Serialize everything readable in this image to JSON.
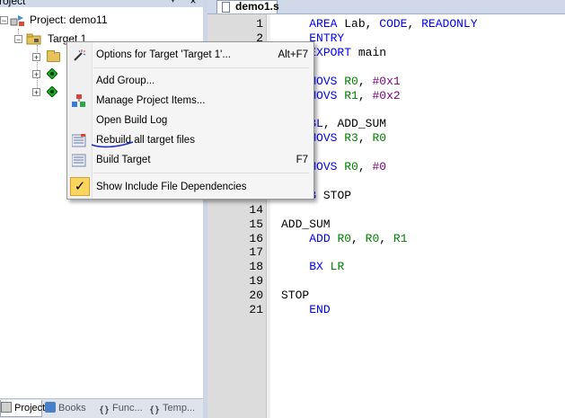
{
  "project_pane": {
    "title": "roject",
    "tree": {
      "project_label": "Project: demo11",
      "target_label": "Target 1"
    },
    "tabs": [
      {
        "label": "Project",
        "icon": "project-icon",
        "active": true
      },
      {
        "label": "Books",
        "icon": "books-icon",
        "active": false
      },
      {
        "label": "Func...",
        "icon": "functions-icon",
        "active": false
      },
      {
        "label": "Temp...",
        "icon": "templates-icon",
        "active": false
      }
    ]
  },
  "editor": {
    "file_tab": "demo1.s",
    "line_numbers": [
      "1",
      "2",
      "3",
      "4",
      "5",
      "6",
      "7",
      "8",
      "9",
      "10",
      "11",
      "12",
      "13",
      "14",
      "15",
      "16",
      "17",
      "18",
      "19",
      "20",
      "21"
    ],
    "code_lines": [
      "    AREA Lab, CODE, READONLY",
      "    ENTRY",
      "    EXPORT main",
      "",
      "    MOVS R0, #0x1",
      "    MOVS R1, #0x2",
      "",
      "    BL, ADD_SUM",
      "    MOVS R3, R0",
      "",
      "    MOVS R0, #0",
      "",
      "    B STOP",
      "",
      "ADD_SUM",
      "    ADD R0, R0, R1",
      "",
      "    BX LR",
      "",
      "STOP",
      "    END"
    ]
  },
  "context_menu": {
    "items": [
      {
        "label": "Options for Target 'Target 1'...",
        "shortcut": "Alt+F7",
        "icon": "options-wand-icon"
      },
      {
        "label": "Add Group...",
        "shortcut": "",
        "icon": ""
      },
      {
        "label": "Manage Project Items...",
        "shortcut": "",
        "icon": "manage-items-icon"
      },
      {
        "label": "Open Build Log",
        "shortcut": "",
        "icon": ""
      },
      {
        "label": "Rebuild all target files",
        "shortcut": "",
        "icon": "rebuild-icon"
      },
      {
        "label": "Build Target",
        "shortcut": "F7",
        "icon": "build-icon"
      },
      {
        "label": "Show Include File Dependencies",
        "shortcut": "",
        "icon": "checkmark-icon",
        "checked": true
      }
    ]
  },
  "colors": {
    "keyword": "#0000ff",
    "number": "#800080",
    "register": "#008000",
    "gutter": "#dcdcdc",
    "menu_background": "#f5f5f5",
    "check_highlight": "#fbd55d"
  }
}
